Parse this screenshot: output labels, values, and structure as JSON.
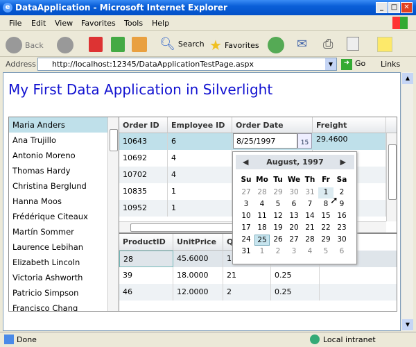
{
  "window": {
    "title": "DataApplication - Microsoft Internet Explorer"
  },
  "menu": [
    "File",
    "Edit",
    "View",
    "Favorites",
    "Tools",
    "Help"
  ],
  "toolbar": {
    "back": "Back",
    "search": "Search",
    "favorites": "Favorites"
  },
  "address": {
    "label": "Address",
    "url": "http://localhost:12345/DataApplicationTestPage.aspx",
    "go": "Go",
    "links": "Links"
  },
  "page": {
    "heading": "My First Data Application in Silverlight"
  },
  "customers": [
    "Maria Anders",
    "Ana Trujillo",
    "Antonio Moreno",
    "Thomas Hardy",
    "Christina Berglund",
    "Hanna Moos",
    "Frédérique Citeaux",
    "Martín Sommer",
    "Laurence Lebihan",
    "Elizabeth Lincoln",
    "Victoria Ashworth",
    "Patricio Simpson",
    "Francisco Chang"
  ],
  "orders": {
    "columns": [
      "Order ID",
      "Employee ID",
      "Order Date",
      "Freight"
    ],
    "rows": [
      [
        "10643",
        "6",
        "8/25/1997",
        "29.4600"
      ],
      [
        "10692",
        "4",
        "",
        ""
      ],
      [
        "10702",
        "4",
        "",
        ""
      ],
      [
        "10835",
        "1",
        "",
        ""
      ],
      [
        "10952",
        "1",
        "",
        ""
      ]
    ]
  },
  "details": {
    "columns": [
      "ProductID",
      "UnitPrice",
      "Q",
      ""
    ],
    "rows": [
      [
        "28",
        "45.6000",
        "15",
        ""
      ],
      [
        "39",
        "18.0000",
        "21",
        "0.25"
      ],
      [
        "46",
        "12.0000",
        "2",
        "0.25"
      ]
    ]
  },
  "calendar": {
    "title": "August, 1997",
    "days": [
      "Su",
      "Mo",
      "Tu",
      "We",
      "Th",
      "Fr",
      "Sa"
    ],
    "weeks": [
      [
        "27",
        "28",
        "29",
        "30",
        "31",
        "1",
        "2"
      ],
      [
        "3",
        "4",
        "5",
        "6",
        "7",
        "8",
        "9"
      ],
      [
        "10",
        "11",
        "12",
        "13",
        "14",
        "15",
        "16"
      ],
      [
        "17",
        "18",
        "19",
        "20",
        "21",
        "22",
        "23"
      ],
      [
        "24",
        "25",
        "26",
        "27",
        "28",
        "29",
        "30"
      ],
      [
        "31",
        "1",
        "2",
        "3",
        "4",
        "5",
        "6"
      ]
    ],
    "selected": "25",
    "hovered": "1",
    "date_icon_label": "15"
  },
  "status": {
    "text": "Done",
    "zone": "Local intranet"
  }
}
